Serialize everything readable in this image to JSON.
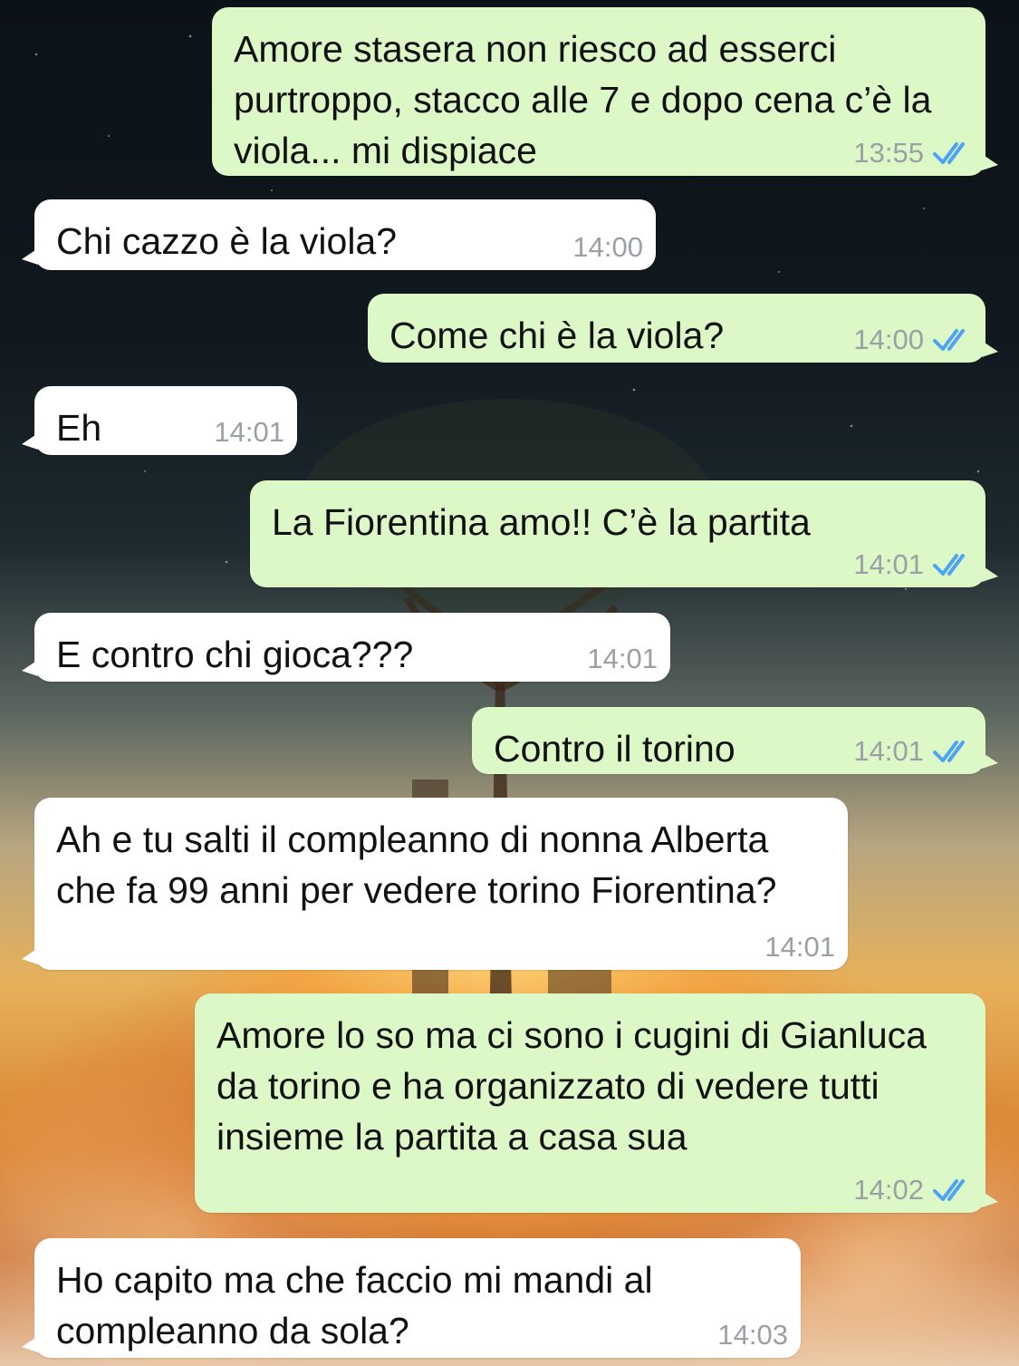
{
  "colors": {
    "outgoing_bubble": "#dcf8c6",
    "incoming_bubble": "#ffffff",
    "timestamp": "#9aa0a6",
    "read_ticks": "#4fa3f7"
  },
  "messages": [
    {
      "direction": "out",
      "text": "Amore stasera non riesco ad esserci purtroppo, stacco alle 7 e dopo cena c’è la viola... mi dispiace",
      "time": "13:55",
      "status_icon": "double-check-icon"
    },
    {
      "direction": "in",
      "text": "Chi cazzo è la viola?",
      "time": "14:00"
    },
    {
      "direction": "out",
      "text": "Come chi è la viola?",
      "time": "14:00",
      "status_icon": "double-check-icon"
    },
    {
      "direction": "in",
      "text": "Eh",
      "time": "14:01"
    },
    {
      "direction": "out",
      "text": "La Fiorentina amo!! C’è la partita",
      "time": "14:01",
      "status_icon": "double-check-icon"
    },
    {
      "direction": "in",
      "text": "E contro chi gioca???",
      "time": "14:01"
    },
    {
      "direction": "out",
      "text": "Contro il torino",
      "time": "14:01",
      "status_icon": "double-check-icon"
    },
    {
      "direction": "in",
      "text": "Ah e tu salti il compleanno di nonna Alberta che fa 99 anni per vedere torino Fiorentina?",
      "time": "14:01"
    },
    {
      "direction": "out",
      "text": "Amore lo so ma ci sono i cugini di Gianluca da torino e ha organizzato di vedere tutti insieme la partita a casa sua",
      "time": "14:02",
      "status_icon": "double-check-icon"
    },
    {
      "direction": "in",
      "text": "Ho capito ma che faccio mi mandi al compleanno da sola?",
      "time": "14:03"
    }
  ]
}
